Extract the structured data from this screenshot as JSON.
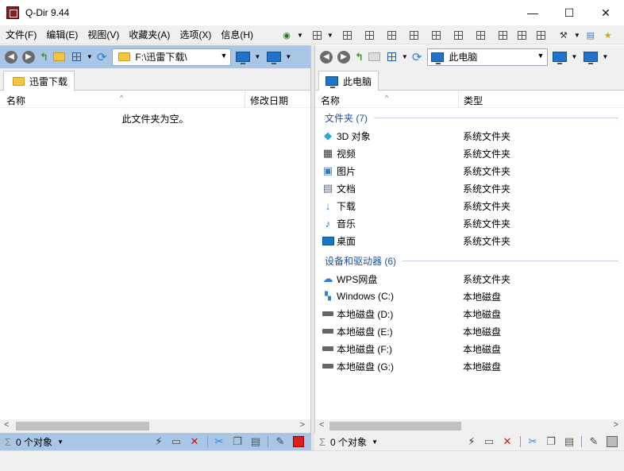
{
  "window": {
    "title": "Q-Dir 9.44",
    "min": "—",
    "max": "☐",
    "close": "✕"
  },
  "menu": [
    {
      "label": "文件(F)"
    },
    {
      "label": "编辑(E)"
    },
    {
      "label": "视图(V)"
    },
    {
      "label": "收藏夹(A)"
    },
    {
      "label": "选项(X)"
    },
    {
      "label": "信息(H)"
    }
  ],
  "left": {
    "address": "F:\\迅雷下载\\",
    "tab": "迅雷下载",
    "columns": {
      "name": "名称",
      "modified": "修改日期"
    },
    "empty": "此文件夹为空。",
    "status": "0 个对象"
  },
  "right": {
    "address": "此电脑",
    "tab": "此电脑",
    "columns": {
      "name": "名称",
      "type": "类型"
    },
    "groups": [
      {
        "title": "文件夹 (7)",
        "items": [
          {
            "name": "3D 对象",
            "type": "系统文件夹",
            "icon": "cube-3d-icon"
          },
          {
            "name": "视频",
            "type": "系统文件夹",
            "icon": "video-icon"
          },
          {
            "name": "图片",
            "type": "系统文件夹",
            "icon": "picture-icon"
          },
          {
            "name": "文档",
            "type": "系统文件夹",
            "icon": "document-icon"
          },
          {
            "name": "下载",
            "type": "系统文件夹",
            "icon": "download-icon"
          },
          {
            "name": "音乐",
            "type": "系统文件夹",
            "icon": "music-icon"
          },
          {
            "name": "桌面",
            "type": "系统文件夹",
            "icon": "desktop-icon"
          }
        ]
      },
      {
        "title": "设备和驱动器 (6)",
        "items": [
          {
            "name": "WPS网盘",
            "type": "系统文件夹",
            "icon": "cloud-icon"
          },
          {
            "name": "Windows (C:)",
            "type": "本地磁盘",
            "icon": "windows-drive-icon"
          },
          {
            "name": "本地磁盘 (D:)",
            "type": "本地磁盘",
            "icon": "drive-icon"
          },
          {
            "name": "本地磁盘 (E:)",
            "type": "本地磁盘",
            "icon": "drive-icon"
          },
          {
            "name": "本地磁盘 (F:)",
            "type": "本地磁盘",
            "icon": "drive-icon"
          },
          {
            "name": "本地磁盘 (G:)",
            "type": "本地磁盘",
            "icon": "drive-icon"
          }
        ]
      }
    ],
    "status": "0 个对象"
  },
  "colors": {
    "active_pane": "#a9c6e6",
    "group_header": "#1e50a0",
    "toolbar": "#f0f0f0"
  }
}
